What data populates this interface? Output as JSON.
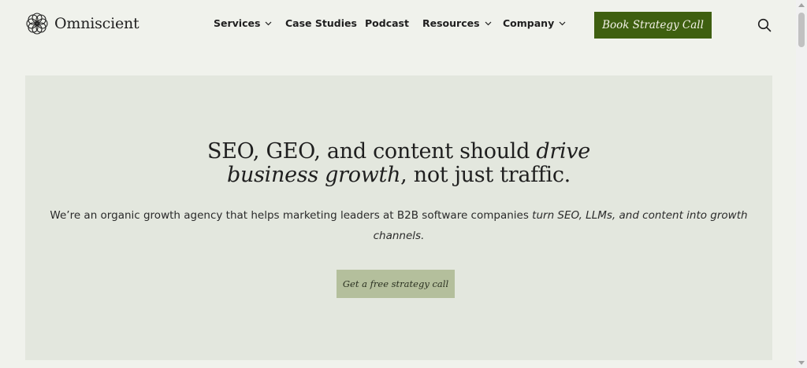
{
  "header": {
    "logo_text": "Omniscient",
    "logo_icon": "omniscient-logo-icon",
    "nav": [
      {
        "label": "Services",
        "has_dropdown": true
      },
      {
        "label": "Case Studies",
        "has_dropdown": false
      },
      {
        "label": "Podcast",
        "has_dropdown": false
      },
      {
        "label": "Resources",
        "has_dropdown": true
      },
      {
        "label": "Company",
        "has_dropdown": true
      }
    ],
    "cta_label": "Book Strategy Call",
    "search_icon": "search-icon"
  },
  "hero": {
    "heading_part1": "SEO, GEO, and content should ",
    "heading_em1": "drive",
    "heading_em2": "business growth",
    "heading_part2": ", not just traffic.",
    "sub_part1": "We’re an organic growth agency that helps marketing leaders at B2B software companies ",
    "sub_em": "turn SEO, LLMs, and content into growth channels.",
    "button_label": "Get a free strategy call"
  },
  "colors": {
    "page_background": "#f0f2ec",
    "hero_background": "#e3e7de",
    "cta_background": "#3e5f10",
    "hero_button_background": "#b4bf9c"
  }
}
